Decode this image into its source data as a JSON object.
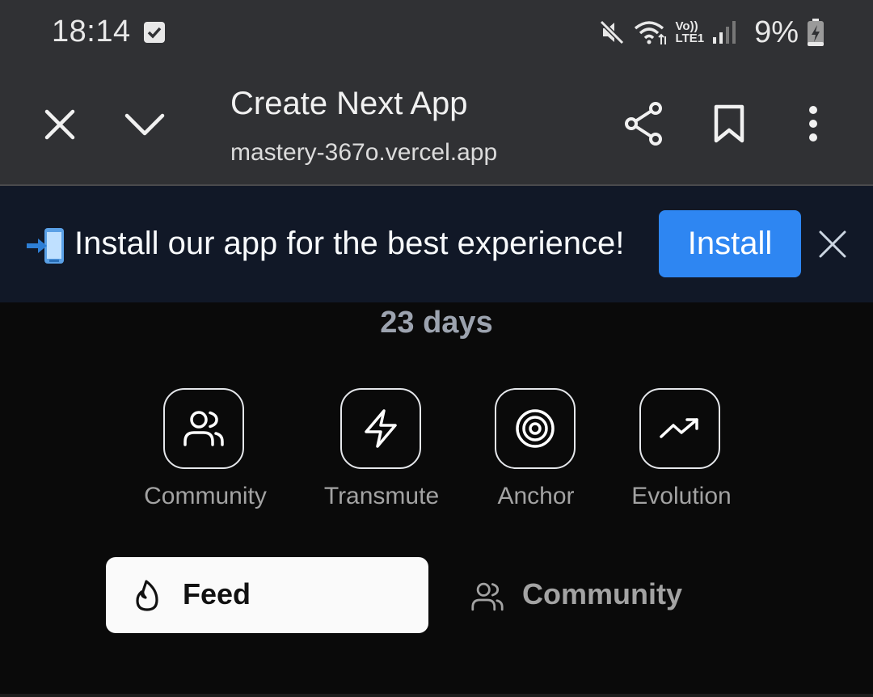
{
  "status": {
    "time": "18:14",
    "network": "Vo))\nLTE1",
    "network_top": "Vo))",
    "network_bottom": "LTE1",
    "battery": "9%"
  },
  "browser": {
    "title": "Create Next App",
    "url": "mastery-367o.vercel.app"
  },
  "banner": {
    "text": "Install our app for the best experience!",
    "install_label": "Install"
  },
  "streak": {
    "days": "23 days"
  },
  "actions": [
    {
      "label": "Community",
      "icon": "users-icon"
    },
    {
      "label": "Transmute",
      "icon": "lightning-icon"
    },
    {
      "label": "Anchor",
      "icon": "target-icon"
    },
    {
      "label": "Evolution",
      "icon": "trending-up-icon"
    }
  ],
  "tabs": [
    {
      "label": "Feed",
      "icon": "flame-icon",
      "active": true
    },
    {
      "label": "Community",
      "icon": "users-icon",
      "active": false
    }
  ],
  "colors": {
    "install_button": "#2e86f2",
    "banner_bg": "#111827",
    "toolbar_bg": "#303134"
  }
}
